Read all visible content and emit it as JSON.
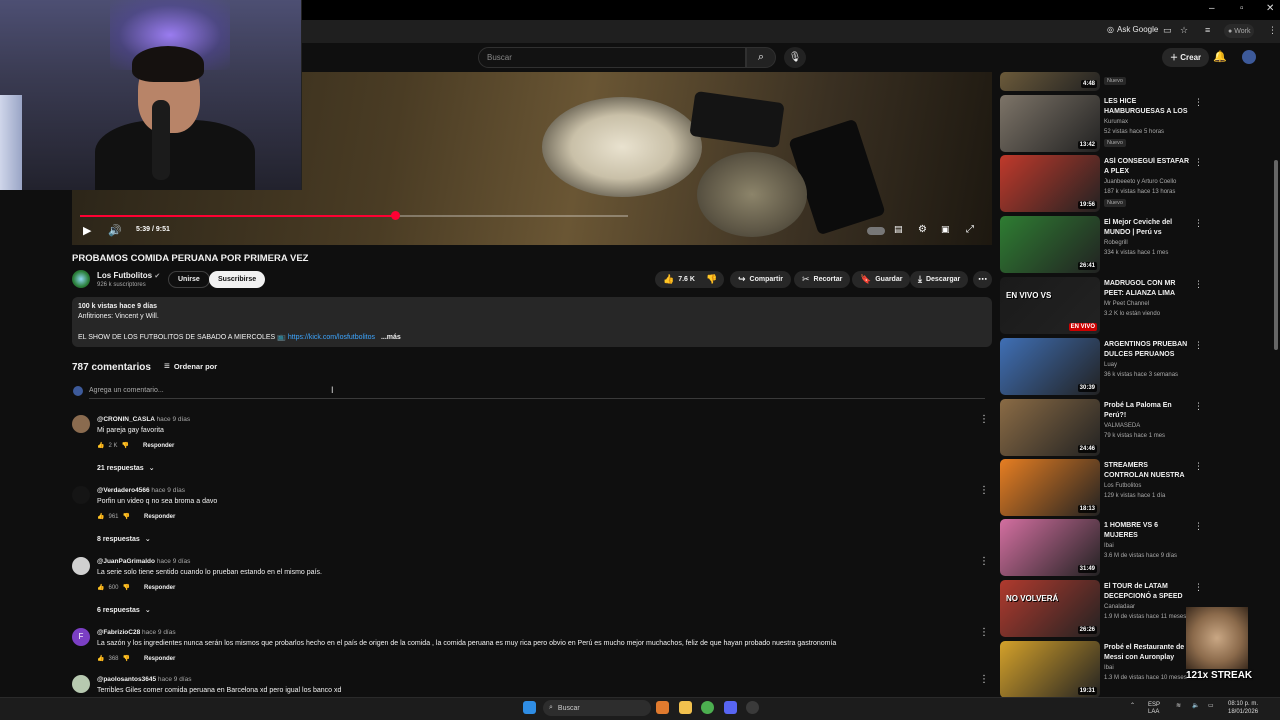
{
  "browser": {
    "ask_google": "Ask Google",
    "profile": "Work"
  },
  "header": {
    "search_placeholder": "Buscar",
    "create_label": "Crear"
  },
  "player": {
    "time": "5:39 / 9:51",
    "progress": 0.575
  },
  "video": {
    "title": "PROBAMOS COMIDA PERUANA POR PRIMERA VEZ",
    "channel": "Los Futbolitos",
    "subscribers": "926 k suscriptores",
    "join_label": "Unirse",
    "subscribe_label": "Suscribirse",
    "likes": "7.6 K",
    "share_label": "Compartir",
    "clip_label": "Recortar",
    "save_label": "Guardar",
    "download_label": "Descargar"
  },
  "description": {
    "stats": "100 k vistas  hace 9 días",
    "hosts": "Anfitriones: Vincent y Will.",
    "schedule": "EL SHOW DE LOS FUTBOLITOS DE SABADO A MIERCOLES",
    "link": "https://kick.com/losfutbolitos",
    "more": "...más"
  },
  "comments": {
    "count": "787 comentarios",
    "sort_label": "Ordenar por",
    "add_placeholder": "Agrega un comentario...",
    "reply_label": "Responder",
    "items": [
      {
        "author": "@CRONIN_CASLA",
        "time": "hace 9 días",
        "text": "Mi pareja gay favorita",
        "likes": "2 K",
        "replies": "21 respuestas"
      },
      {
        "author": "@Verdadero4566",
        "time": "hace 9 días",
        "text": "Porfin  un video q no sea broma a davo",
        "likes": "961",
        "replies": "8 respuestas"
      },
      {
        "author": "@JuanPaGrimaldo",
        "time": "hace 9 días",
        "text": "La serie solo tiene sentido cuando lo prueban estando en el mismo país.",
        "likes": "600",
        "replies": "6 respuestas"
      },
      {
        "author": "@FabrizioC28",
        "time": "hace 9 días",
        "text": "La sazón y los ingredientes nunca serán los mismos que probarlos hecho en el país de origen de la comida , la comida peruana es muy rica pero obvio en Perú es mucho mejor muchachos, feliz de que hayan probado nuestra gastronomía",
        "likes": "368",
        "replies": ""
      },
      {
        "author": "@paolosantos3645",
        "time": "hace 9 días",
        "text": "Terribles Giles comer comida peruana en Barcelona xd pero igual los banco xd",
        "likes": "",
        "replies": ""
      }
    ]
  },
  "sidebar": {
    "items": [
      {
        "title": "",
        "channel": "",
        "meta": "",
        "badge": "Nuevo",
        "duration": "4:48"
      },
      {
        "title": "LES HICE HAMBURGUESAS A LOS ...",
        "channel": "Kurumax",
        "meta": "52 vistas  hace 5 horas",
        "badge": "Nuevo",
        "duration": "13:42"
      },
      {
        "title": "ASÍ CONSEGUÍ ESTAFAR A PLEX",
        "channel": "Juanbeeeto y Arturo Coello",
        "meta": "187 k vistas  hace 13 horas",
        "badge": "Nuevo",
        "duration": "19:56"
      },
      {
        "title": "El Mejor Ceviche del MUNDO | Perú vs México...",
        "channel": "Robegrill",
        "meta": "334 k vistas  hace 1 mes",
        "badge": "",
        "duration": "26:41"
      },
      {
        "title": "MADRUGOL CON MR PEET: ALIANZA LIMA VS...",
        "channel": "Mr Peet Channel",
        "meta": "3.2 K lo están viendo",
        "badge": "",
        "duration": "EN VIVO"
      },
      {
        "title": "ARGENTINOS PRUEBAN DULCES PERUANOS POR...",
        "channel": "Luay",
        "meta": "36 k vistas  hace 3 semanas",
        "badge": "",
        "duration": "30:39"
      },
      {
        "title": "Probé La Paloma En Perú?!",
        "channel": "VALMASEDA",
        "meta": "79 k vistas  hace 1 mes",
        "badge": "",
        "duration": "24:46"
      },
      {
        "title": "STREAMERS CONTROLAN NUESTRA VIDA POR 24 ...",
        "channel": "Los Futbolitos",
        "meta": "129 k vistas  hace 1 día",
        "badge": "",
        "duration": "18:13"
      },
      {
        "title": "1 HOMBRE VS 6 MUJERES",
        "channel": "Ibai",
        "meta": "3.6 M de vistas  hace 9 días",
        "badge": "",
        "duration": "31:49"
      },
      {
        "title": "El TOUR de LATAM DECEPCIONÓ a SPEED",
        "channel": "Canaladaar",
        "meta": "1.9 M de vistas  hace 11 meses",
        "badge": "",
        "duration": "26:26"
      },
      {
        "title": "Probé el Restaurante de Messi con Auronplay",
        "channel": "Ibai",
        "meta": "1.3 M de vistas  hace 10 meses",
        "badge": "",
        "duration": "19:31"
      }
    ],
    "thumb_colors": [
      "#6b5a3a",
      "#7d7468",
      "#c0392b",
      "#2e7d32",
      "#1a1a1a",
      "#3f6fb5",
      "#8a6b45",
      "#e67e22",
      "#d36fa0",
      "#b03a2e",
      "#d4a12a"
    ],
    "thumb_texts": [
      "",
      "",
      "",
      "",
      "EN VIVO VS",
      "",
      "",
      "",
      "",
      "NO VOLVERÁ",
      ""
    ]
  },
  "overlay": {
    "streak": "121x STREAK"
  },
  "taskbar": {
    "search": "Buscar",
    "lang": "ESP\nLAA",
    "time": "08:10 p. m.",
    "date": "18/01/2026"
  },
  "colors": {
    "accent_red": "#ff0033",
    "link_blue": "#3ea6ff"
  }
}
